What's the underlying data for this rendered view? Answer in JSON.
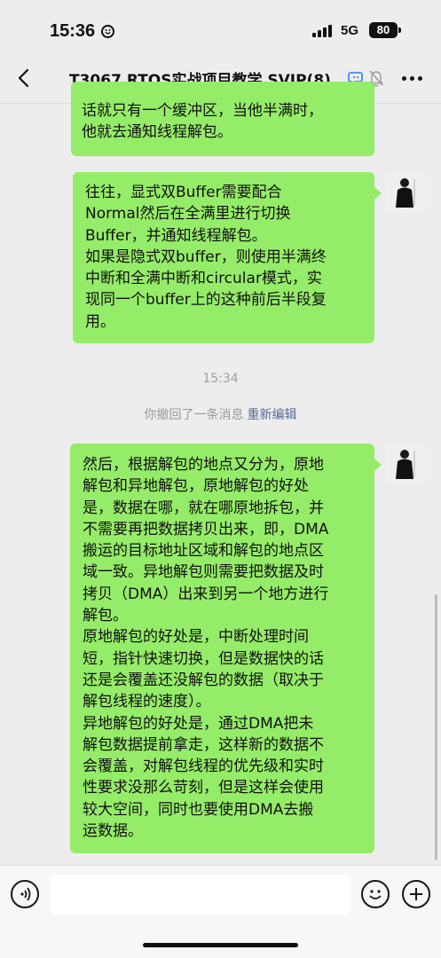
{
  "status_bar": {
    "time": "15:36",
    "network": "5G",
    "battery": "80"
  },
  "header": {
    "back_icon": "chevron-left-icon",
    "title": "T3067 RTOS实战项目教学 SVIP(8)",
    "chat_icon": "chat-bubbles-icon",
    "mute_icon": "bell-muted-icon",
    "more_icon": "more-dots-icon"
  },
  "messages": [
    {
      "sender": "me",
      "text": "话就只有一个缓冲区，当他半满时，\n他就去通知线程解包。"
    },
    {
      "sender": "me",
      "text": "往往，显式双Buffer需要配合\nNormal然后在全满里进行切换\nBuffer，并通知线程解包。\n如果是隐式双buffer，则使用半满终\n中断和全满中断和circular模式，实\n现同一个buffer上的这种前后半段复\n用。"
    },
    {
      "sender": "me",
      "text": "然后，根据解包的地点又分为，原地\n解包和异地解包，原地解包的好处\n是，数据在哪，就在哪原地拆包，并\n不需要再把数据拷贝出来，即，DMA\n搬运的目标地址区域和解包的地点区\n域一致。异地解包则需要把数据及时\n拷贝（DMA）出来到另一个地方进行\n解包。\n原地解包的好处是，中断处理时间\n短，指针快速切换，但是数据快的话\n还是会覆盖还没解包的数据（取决于\n解包线程的速度）。\n异地解包的好处是，通过DMA把未\n解包数据提前拿走，这样新的数据不\n会覆盖，对解包线程的优先级和实时\n性要求没那么苛刻，但是这样会使用\n较大空间，同时也要使用DMA去搬\n运数据。"
    }
  ],
  "timestamp": "15:34",
  "recall_notice": {
    "text": "你撤回了一条消息",
    "edit_label": "重新编辑"
  },
  "input_bar": {
    "voice_icon": "voice-input-icon",
    "text_value": "",
    "emoji_icon": "emoji-icon",
    "plus_icon": "plus-icon"
  },
  "colors": {
    "bubble": "#95ec69",
    "background": "#ededed",
    "link": "#576b95"
  }
}
